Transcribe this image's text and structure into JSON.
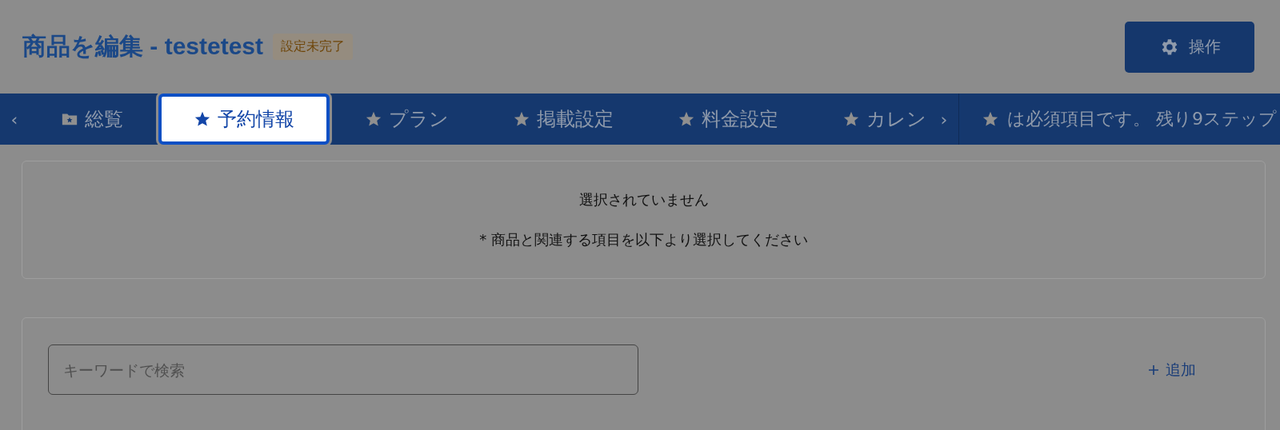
{
  "header": {
    "title": "商品を編集 - testetest",
    "status_badge": "設定未完了",
    "action_button": "操作"
  },
  "tabs": [
    {
      "label": "総覧",
      "kind": "folder",
      "selected": false
    },
    {
      "label": "予約情報",
      "kind": "star",
      "selected": true
    },
    {
      "label": "プラン",
      "kind": "star",
      "selected": false
    },
    {
      "label": "掲載設定",
      "kind": "star",
      "selected": false
    },
    {
      "label": "料金設定",
      "kind": "star",
      "selected": false
    },
    {
      "label": "カレン",
      "kind": "star",
      "selected": false
    }
  ],
  "scroll_left": "‹",
  "scroll_right": "›",
  "tab_hint": "は必須項目です。 残り9ステップ",
  "selection": {
    "message": "選択されていません",
    "note": "* 商品と関連する項目を以下より選択してください"
  },
  "search": {
    "placeholder": "キーワードで検索",
    "add_label": "追加"
  }
}
